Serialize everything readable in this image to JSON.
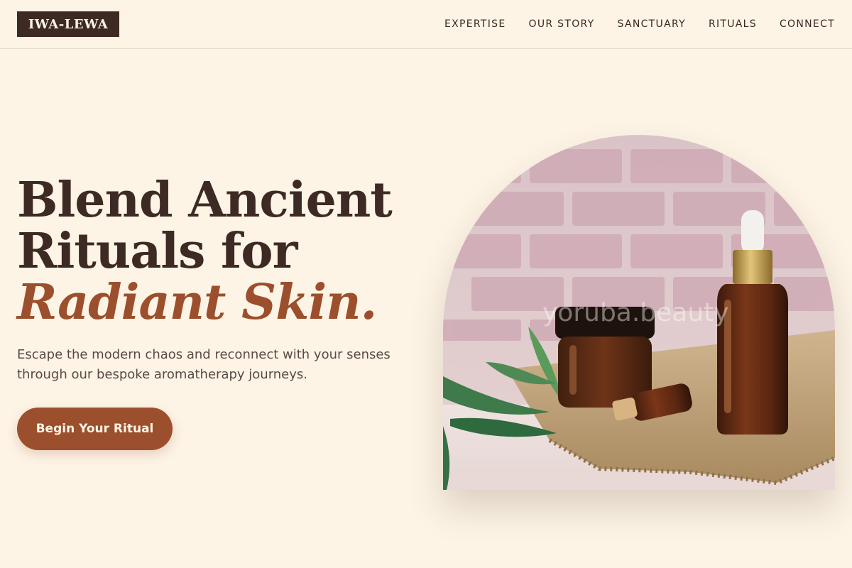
{
  "brand": {
    "logo": "IWA-LEWA"
  },
  "nav": {
    "items": [
      {
        "label": "EXPERTISE"
      },
      {
        "label": "OUR STORY"
      },
      {
        "label": "SANCTUARY"
      },
      {
        "label": "RITUALS"
      },
      {
        "label": "CONNECT"
      }
    ]
  },
  "hero": {
    "headline_line1": "Blend Ancient",
    "headline_line2": "Rituals for",
    "headline_accent": "Radiant Skin.",
    "subtext": "Escape the modern chaos and reconnect with your senses through our bespoke aromatherapy journeys.",
    "cta_label": "Begin Your Ritual",
    "image_watermark": "yoruba.beauty"
  },
  "colors": {
    "background": "#fdf4e6",
    "dark_brown": "#3e2a24",
    "accent_rust": "#9c4f2c"
  }
}
